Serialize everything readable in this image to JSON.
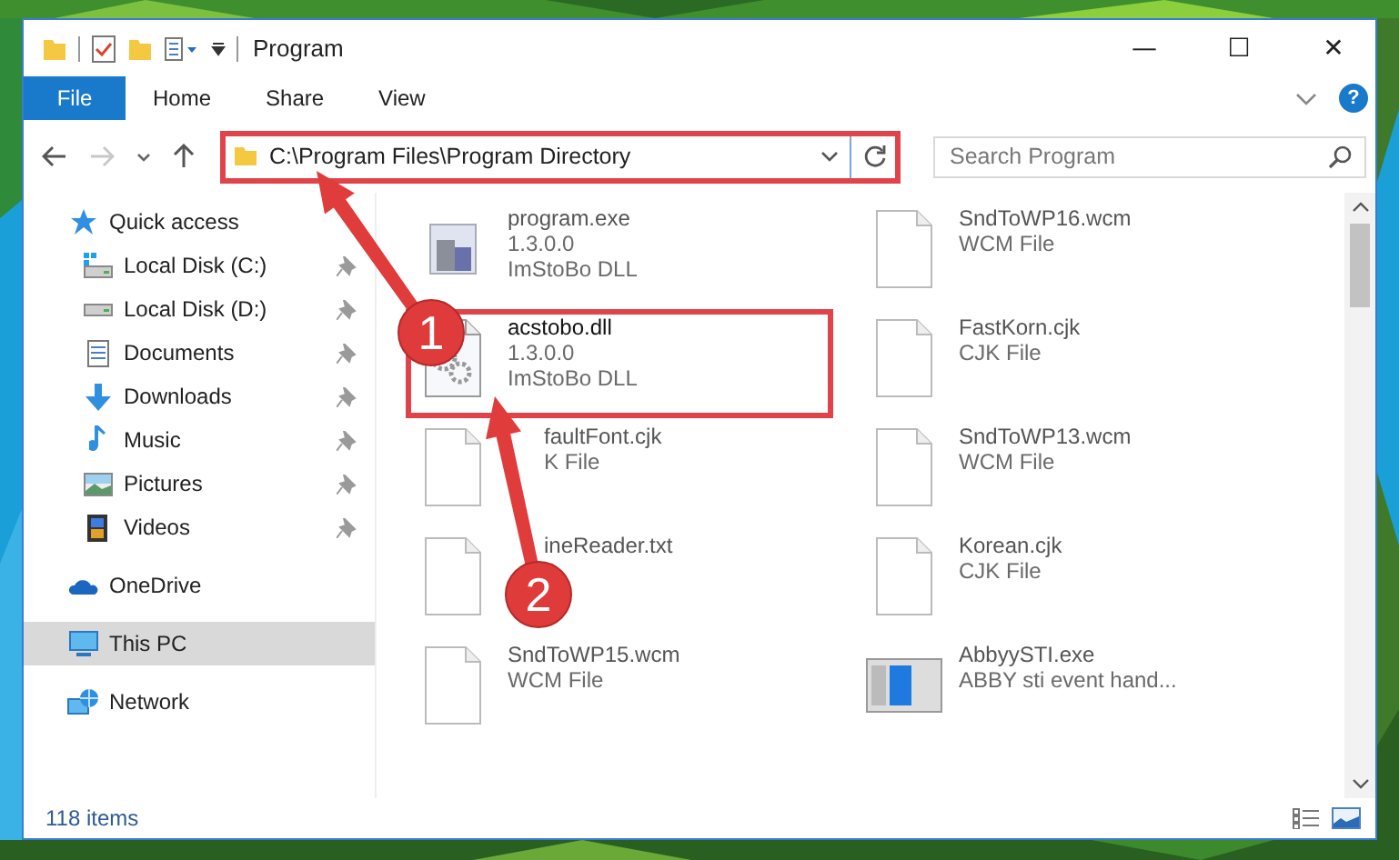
{
  "window": {
    "title": "Program",
    "controls": [
      "—",
      "☐",
      "✕"
    ]
  },
  "ribbon": {
    "tabs": [
      {
        "label": "File",
        "selected": true
      },
      {
        "label": "Home",
        "selected": false
      },
      {
        "label": "Share",
        "selected": false
      },
      {
        "label": "View",
        "selected": false
      }
    ],
    "help": "?"
  },
  "address_bar": {
    "path": "C:\\Program Files\\Program Directory",
    "highlighted": true
  },
  "search": {
    "placeholder": "Search Program"
  },
  "navigation": [
    {
      "label": "Quick access",
      "kind": "star",
      "selected": false,
      "children": [
        {
          "label": "Local Disk (C:)",
          "kind": "system_drive",
          "pinned": true,
          "selected": false
        },
        {
          "label": "Local Disk (D:)",
          "kind": "drive",
          "pinned": true,
          "selected": false
        },
        {
          "label": "Documents",
          "kind": "document",
          "pinned": true,
          "selected": false
        },
        {
          "label": "Downloads",
          "kind": "download",
          "pinned": true,
          "selected": false
        },
        {
          "label": "Music",
          "kind": "music",
          "pinned": true,
          "selected": false
        },
        {
          "label": "Pictures",
          "kind": "pictures",
          "pinned": true,
          "selected": false
        },
        {
          "label": "Videos",
          "kind": "video",
          "pinned": true,
          "selected": false
        }
      ]
    },
    {
      "label": "OneDrive",
      "kind": "cloud",
      "selected": false
    },
    {
      "label": "This PC",
      "kind": "computer",
      "selected": true
    },
    {
      "label": "Network",
      "kind": "network",
      "selected": false
    }
  ],
  "files": [
    {
      "name": "program.exe",
      "details": [
        "1.3.0.0",
        "ImStoBo DLL"
      ],
      "kind": "program",
      "highlighted": false
    },
    {
      "name": "SndToWP16.wcm",
      "details": [
        "WCM File"
      ],
      "kind": "blank",
      "highlighted": false
    },
    {
      "name": "acstobo.dll",
      "details": [
        "1.3.0.0",
        "ImStoBo DLL"
      ],
      "kind": "gears",
      "highlighted": true
    },
    {
      "name": "FastKorn.cjk",
      "details": [
        "CJK File"
      ],
      "kind": "blank",
      "highlighted": false
    },
    {
      "name": "faultFont.cjk",
      "details": [
        "K File"
      ],
      "kind": "covered",
      "highlighted": false
    },
    {
      "name": "SndToWP13.wcm",
      "details": [
        "WCM File"
      ],
      "kind": "blank",
      "highlighted": false
    },
    {
      "name": "ineReader.txt",
      "kind": "covered",
      "highlighted": false
    },
    {
      "name": "Korean.cjk",
      "details": [
        "CJK File"
      ],
      "kind": "blank",
      "highlighted": false
    },
    {
      "name": "SndToWP15.wcm",
      "details": [
        "WCM File"
      ],
      "kind": "blank",
      "highlighted": false
    },
    {
      "name": "AbbyySTI.exe",
      "details": [
        "ABBY sti event hand..."
      ],
      "kind": "window",
      "highlighted": false
    }
  ],
  "status_bar": {
    "count": "118 items"
  },
  "annotations": [
    {
      "number": "1"
    },
    {
      "number": "2"
    }
  ]
}
